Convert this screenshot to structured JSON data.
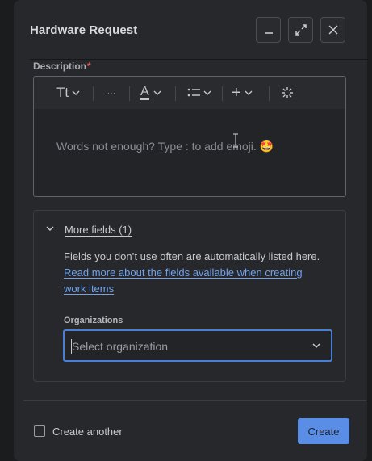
{
  "dialog": {
    "title": "Hardware Request"
  },
  "description": {
    "label": "Description",
    "required_marker": "*",
    "placeholder": "Words not enough? Type : to add emoji. 🤩",
    "toolbar": {
      "text_style": "Tt",
      "more": "···",
      "text_color": "A",
      "list": "list-icon",
      "insert": "+",
      "ai": "sparkle-icon"
    }
  },
  "more_fields": {
    "label": "More fields (1)",
    "text": "Fields you don’t use often are automatically listed here. ",
    "link": "Read more about the fields available when creating work items"
  },
  "organizations": {
    "label": "Organizations",
    "placeholder": "Select organization"
  },
  "footer": {
    "checkbox_label": "Create another",
    "create_label": "Create"
  },
  "colors": {
    "accent": "#5a8ee6",
    "focus_border": "#4a7fd8",
    "link": "#6fa2f0",
    "required": "#e2584e",
    "dialog_bg": "#27282b"
  }
}
